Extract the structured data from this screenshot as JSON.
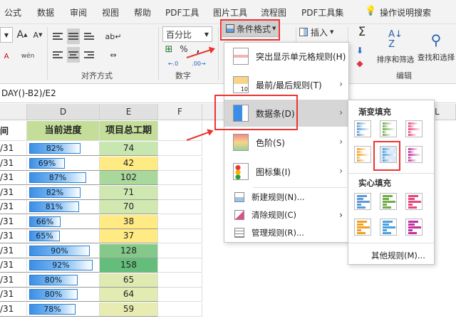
{
  "tabs": [
    "公式",
    "数据",
    "审阅",
    "视图",
    "帮助",
    "PDF工具",
    "图片工具",
    "流程图",
    "PDF工具集",
    "操作说明搜索"
  ],
  "ribbon": {
    "font_labels": [
      "A",
      "A"
    ],
    "number_format": "百分比",
    "number_symbols": [
      "%",
      ",",
      "←.0",
      ".00→"
    ],
    "alignment_group": "对齐方式",
    "number_group": "数字",
    "conditional_format": "条件格式",
    "insert": "插入",
    "sort_filter": "排序和筛选",
    "find_select": "查找和选择",
    "edit_group": "编辑",
    "sigma": "Σ"
  },
  "formula_text": "DAY()-B2)/E2",
  "columns": [
    "D",
    "E",
    "F",
    "L"
  ],
  "headers": {
    "b": "间",
    "d": "当前进度",
    "e": "项目总工期"
  },
  "rows": [
    {
      "date": "/31",
      "progress": "82%",
      "pct": 82,
      "days": "74",
      "color": "#c8e6b0"
    },
    {
      "date": "/31",
      "progress": "69%",
      "pct": 69,
      "days": "42",
      "color": "#ffeb84"
    },
    {
      "date": "/31",
      "progress": "87%",
      "pct": 87,
      "days": "102",
      "color": "#a8d89c"
    },
    {
      "date": "/31",
      "progress": "82%",
      "pct": 82,
      "days": "71",
      "color": "#cfe7b0"
    },
    {
      "date": "/31",
      "progress": "81%",
      "pct": 81,
      "days": "70",
      "color": "#d2e8b1"
    },
    {
      "date": "/31",
      "progress": "66%",
      "pct": 66,
      "days": "38",
      "color": "#ffea84"
    },
    {
      "date": "/31",
      "progress": "65%",
      "pct": 65,
      "days": "37",
      "color": "#ffea84"
    },
    {
      "date": "/31",
      "progress": "90%",
      "pct": 90,
      "days": "128",
      "color": "#84c98a"
    },
    {
      "date": "/31",
      "progress": "92%",
      "pct": 92,
      "days": "158",
      "color": "#63be7b"
    },
    {
      "date": "/31",
      "progress": "80%",
      "pct": 80,
      "days": "65",
      "color": "#dfeab2"
    },
    {
      "date": "/31",
      "progress": "80%",
      "pct": 80,
      "days": "64",
      "color": "#e1ebb2"
    },
    {
      "date": "/31",
      "progress": "78%",
      "pct": 78,
      "days": "59",
      "color": "#e9ecb2"
    }
  ],
  "menu": {
    "highlight": "突出显示单元格规则(H)",
    "topbottom": "最前/最后规则(T)",
    "databar": "数据条(D)",
    "colorscale": "色阶(S)",
    "iconset": "图标集(I)",
    "new_rule": "新建规则(N)...",
    "clear_rule": "清除规则(C)",
    "manage_rule": "管理规则(R)..."
  },
  "submenu": {
    "gradient": "渐变填充",
    "solid": "实心填充",
    "more": "其他规则(M)..."
  },
  "swatch_colors": [
    "#5b9bd5",
    "#70ad47",
    "#e8457a",
    "#f0a020",
    "#4aa0e0",
    "#c030a0"
  ]
}
